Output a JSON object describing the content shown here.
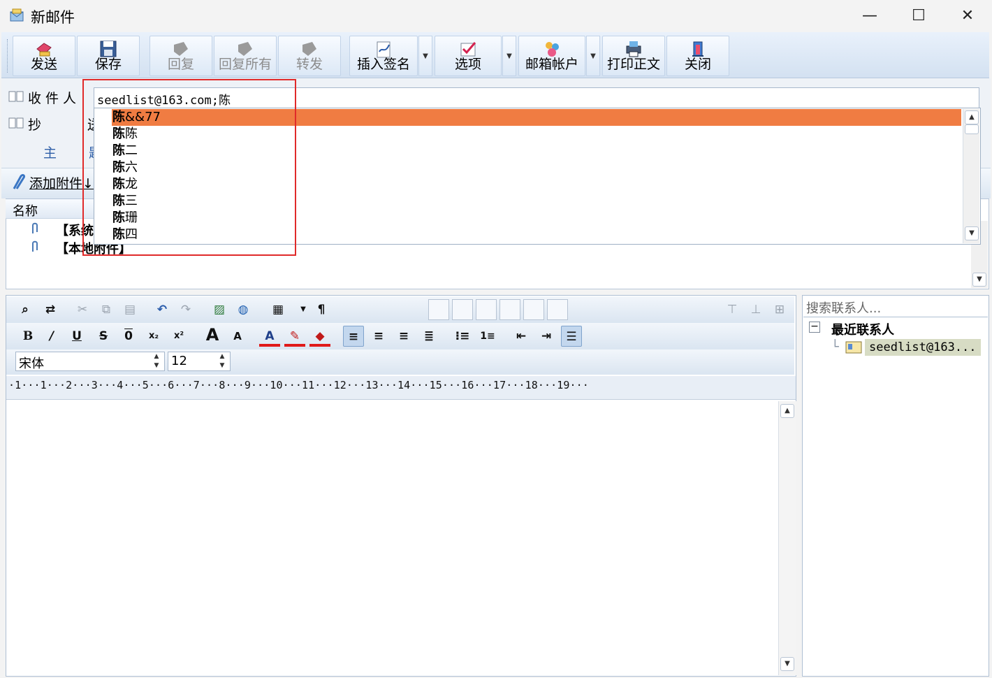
{
  "window": {
    "title": "新邮件",
    "minimize": "—",
    "maximize": "☐",
    "close": "✕"
  },
  "toolbar": {
    "send": "发送",
    "save": "保存",
    "reply": "回复",
    "reply_all": "回复所有",
    "forward": "转发",
    "insert_signature": "插入签名",
    "options": "选项",
    "mail_account": "邮箱帐户",
    "print_body": "打印正文",
    "close": "关闭"
  },
  "fields": {
    "to_label": "收件人",
    "cc_label": "抄 送",
    "subject_label": "主 题:",
    "to_value": "seedlist@163.com;陈"
  },
  "suggestions": [
    {
      "bold": "陈",
      "rest": "&&77",
      "selected": true
    },
    {
      "bold": "陈",
      "rest": "陈",
      "selected": false
    },
    {
      "bold": "陈",
      "rest": "二",
      "selected": false
    },
    {
      "bold": "陈",
      "rest": "六",
      "selected": false
    },
    {
      "bold": "陈",
      "rest": "龙",
      "selected": false
    },
    {
      "bold": "陈",
      "rest": "三",
      "selected": false
    },
    {
      "bold": "陈",
      "rest": "珊",
      "selected": false
    },
    {
      "bold": "陈",
      "rest": "四",
      "selected": false
    }
  ],
  "attachments": {
    "add_label": "添加附件↓",
    "column_name": "名称",
    "rows": [
      "【系统附件】",
      "【本地附件】"
    ]
  },
  "editor": {
    "font": "宋体",
    "size": "12",
    "ruler": "·1···1···2···3···4···5···6···7···8···9···10···11···12···13···14···15···16···17···18···19···"
  },
  "contacts": {
    "search_placeholder": "搜索联系人...",
    "group": "最近联系人",
    "items": [
      "seedlist@163..."
    ]
  }
}
